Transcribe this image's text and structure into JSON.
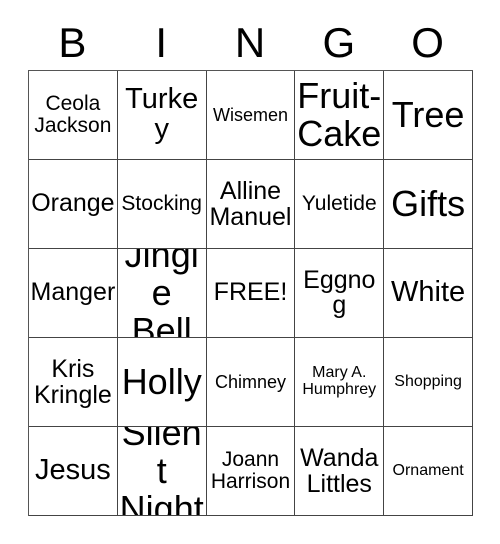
{
  "card": {
    "title_letters": [
      "B",
      "I",
      "N",
      "G",
      "O"
    ],
    "columns": [
      "B",
      "I",
      "N",
      "G",
      "O"
    ],
    "free_space_text": "FREE!",
    "rows": [
      [
        {
          "text": "Ceola Jackson",
          "size": "fs-m",
          "lines": 2
        },
        {
          "text": "Turkey",
          "size": "fs-xl",
          "lines": 1
        },
        {
          "text": "Wisemen",
          "size": "fs-s",
          "lines": 1
        },
        {
          "text": "Fruit-Cake",
          "size": "fs-xxl",
          "lines": 2
        },
        {
          "text": "Tree",
          "size": "fs-xxl",
          "lines": 1
        }
      ],
      [
        {
          "text": "Orange",
          "size": "fs-l",
          "lines": 1
        },
        {
          "text": "Stocking",
          "size": "fs-m",
          "lines": 1
        },
        {
          "text": "Alline Manuel",
          "size": "fs-l",
          "lines": 2
        },
        {
          "text": "Yuletide",
          "size": "fs-m",
          "lines": 1
        },
        {
          "text": "Gifts",
          "size": "fs-xxl",
          "lines": 1
        }
      ],
      [
        {
          "text": "Manger",
          "size": "fs-l",
          "lines": 1
        },
        {
          "text": "Jingle Bell",
          "size": "fs-xxl",
          "lines": 2
        },
        {
          "text": "FREE!",
          "size": "fs-l",
          "lines": 1
        },
        {
          "text": "Eggnog",
          "size": "fs-l",
          "lines": 1
        },
        {
          "text": "White",
          "size": "fs-xl",
          "lines": 1
        }
      ],
      [
        {
          "text": "Kris Kringle",
          "size": "fs-l",
          "lines": 2
        },
        {
          "text": "Holly",
          "size": "fs-xxl",
          "lines": 1
        },
        {
          "text": "Chimney",
          "size": "fs-s",
          "lines": 1
        },
        {
          "text": "Mary A. Humphrey",
          "size": "fs-xs",
          "lines": 2
        },
        {
          "text": "Shopping",
          "size": "fs-xs",
          "lines": 1
        }
      ],
      [
        {
          "text": "Jesus",
          "size": "fs-xl",
          "lines": 1
        },
        {
          "text": "Silent Night",
          "size": "fs-xxl",
          "lines": 2
        },
        {
          "text": "Joann Harrison",
          "size": "fs-m",
          "lines": 2
        },
        {
          "text": "Wanda Littles",
          "size": "fs-l",
          "lines": 2
        },
        {
          "text": "Ornament",
          "size": "fs-xs",
          "lines": 1
        }
      ]
    ]
  },
  "style": {
    "background": "#ffffff",
    "text_color": "#000000",
    "border_color": "#444444"
  }
}
